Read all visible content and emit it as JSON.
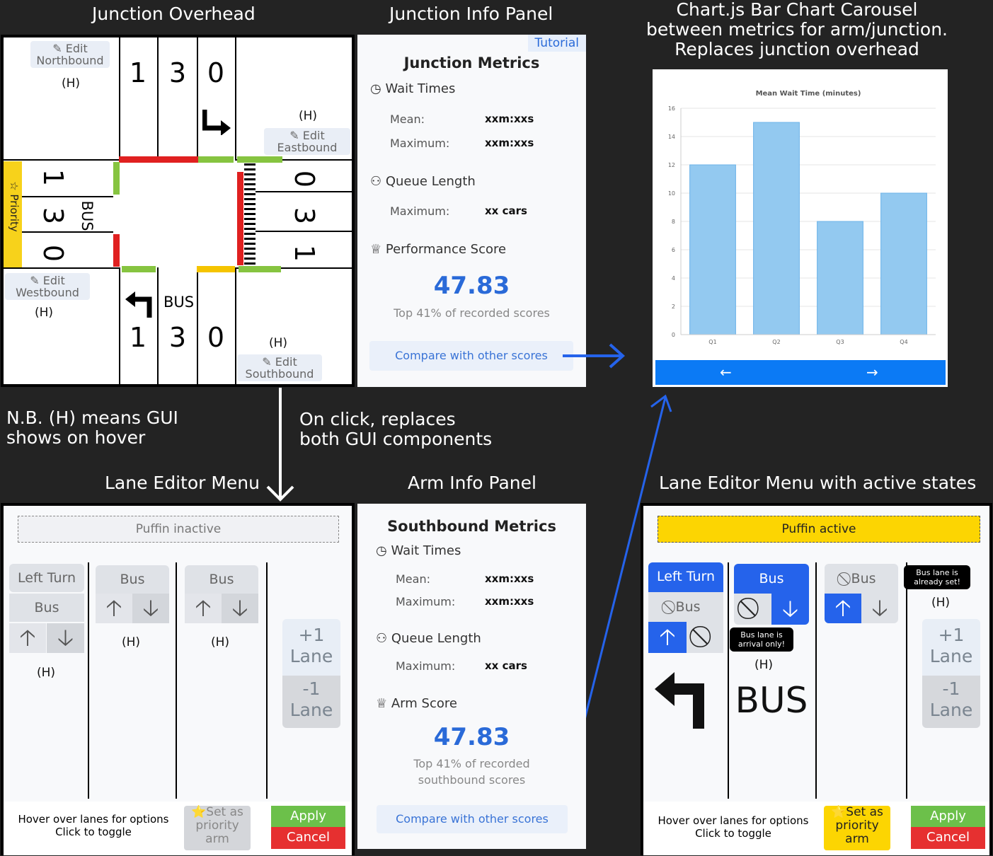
{
  "titles": {
    "junction_overhead": "Junction Overhead",
    "junction_info": "Junction Info Panel",
    "carousel": "Chart.js Bar Chart Carousel\nbetween metrics for arm/junction.\nReplaces junction overhead",
    "lane_editor": "Lane Editor Menu",
    "arm_info": "Arm Info Panel",
    "lane_editor_active": "Lane Editor Menu with active states"
  },
  "notes": {
    "hover": "N.B. (H) means GUI\nshows on hover",
    "click": "On click, replaces\nboth GUI components"
  },
  "junction": {
    "hover_mark": "(H)",
    "edit_north": "Edit\nNorthbound",
    "edit_east": "Edit\nEastbound",
    "edit_west": "Edit\nWestbound",
    "edit_south": "Edit\nSouthbound",
    "north_lanes": [
      "1",
      "3",
      "0"
    ],
    "south_lanes": [
      "1",
      "3",
      "0"
    ],
    "west_lanes": [
      "1",
      "3",
      "0"
    ],
    "east_lanes": [
      "0",
      "3",
      "1"
    ],
    "bus": "BUS",
    "priority": "Priority"
  },
  "junction_info": {
    "tutorial": "Tutorial",
    "heading": "Junction Metrics",
    "wait_times": "Wait Times",
    "mean_label": "Mean:",
    "mean_value": "xxm:xxs",
    "max_label": "Maximum:",
    "max_value": "xxm:xxs",
    "queue_length": "Queue Length",
    "queue_max_label": "Maximum:",
    "queue_max_value": "xx cars",
    "perf_score": "Performance Score",
    "score": "47.83",
    "score_caption": "Top 41% of recorded scores",
    "compare": "Compare with other scores"
  },
  "chart_data": {
    "type": "bar",
    "title": "Mean Wait Time (minutes)",
    "categories": [
      "Q1",
      "Q2",
      "Q3",
      "Q4"
    ],
    "values": [
      12,
      15,
      8,
      10
    ],
    "ylim": [
      0,
      16
    ],
    "yticks": [
      0,
      2,
      4,
      6,
      8,
      10,
      12,
      14,
      16
    ],
    "grid": true,
    "bar_color": "#93c9f0",
    "nav_left": "←",
    "nav_right": "→"
  },
  "lane_editor": {
    "puffin": "Puffin inactive",
    "left_turn": "Left Turn",
    "bus": "Bus",
    "up": "🡡",
    "down": "🡣",
    "hover_mark": "(H)",
    "plus_lane": "+1\nLane",
    "minus_lane": "-1\nLane",
    "hint": "Hover over lanes for options\nClick to toggle",
    "set_priority": "Set as\npriority\narm",
    "apply": "Apply",
    "cancel": "Cancel"
  },
  "arm_info": {
    "heading": "Southbound Metrics",
    "wait_times": "Wait Times",
    "mean_label": "Mean:",
    "mean_value": "xxm:xxs",
    "max_label": "Maximum:",
    "max_value": "xxm:xxs",
    "queue_length": "Queue Length",
    "queue_max_label": "Maximum:",
    "queue_max_value": "xx cars",
    "arm_score": "Arm Score",
    "score": "47.83",
    "score_caption": "Top 41% of recorded\nsouthbound scores",
    "compare": "Compare with other scores"
  },
  "lane_editor_active": {
    "puffin": "Puffin active",
    "left_turn": "Left Turn",
    "bus": "Bus",
    "tooltip_set": "Bus lane is\nalready set!",
    "tooltip_arrival": "Bus lane is\narrival only!",
    "hover_mark": "(H)",
    "bus_marking": "BUS",
    "plus_lane": "+1\nLane",
    "minus_lane": "-1\nLane",
    "hint": "Hover over lanes for options\nClick to toggle",
    "set_priority": "Set as\npriority\narm",
    "apply": "Apply",
    "cancel": "Cancel"
  },
  "colors": {
    "signal_red": "#e02020",
    "signal_green": "#86c440",
    "signal_yellow": "#f5c400",
    "priority_yellow": "#f7d21b",
    "blue": "#2563eb"
  }
}
